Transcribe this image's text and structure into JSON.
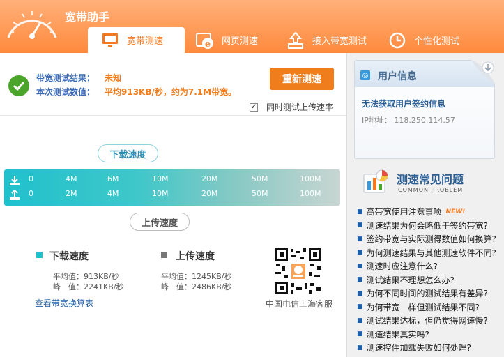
{
  "app": {
    "title": "宽带助手"
  },
  "tabs": [
    {
      "label": "宽带测速",
      "icon": "monitor-icon",
      "active": true
    },
    {
      "label": "网页测速",
      "icon": "ie-browser-icon",
      "active": false
    },
    {
      "label": "接入带宽测试",
      "icon": "upload-tray-icon",
      "active": false
    },
    {
      "label": "个性化测试",
      "icon": "clock-icon",
      "active": false
    }
  ],
  "result": {
    "bandwidth_label": "带宽测试结果：",
    "bandwidth_value": "未知",
    "speed_label": "本次测试数值：",
    "speed_value": "平均913KB/秒，约为7.1M带宽。",
    "retest_label": "重新测速",
    "upload_checkbox_label": "同时测试上传速率",
    "upload_checked": true
  },
  "meter": {
    "download_pill": "下载速度",
    "upload_pill": "上传速度",
    "download_ticks": [
      "0",
      "4M",
      "6M",
      "10M",
      "20M",
      "50M",
      "100M"
    ],
    "upload_ticks": [
      "0",
      "2M",
      "4M",
      "10M",
      "20M",
      "50M",
      "100M"
    ]
  },
  "stats": {
    "download_title": "下载速度",
    "download_avg": "平均值：913KB/秒",
    "download_peak": "峰　值：2241KB/秒",
    "upload_title": "上传速度",
    "upload_avg": "平均值：1245KB/秒",
    "upload_peak": "峰　值：2486KB/秒",
    "rate_table_link": "查看带宽换算表",
    "qr_caption": "中国电信上海客服"
  },
  "user_info": {
    "title": "用户信息",
    "warning": "无法获取用户签约信息",
    "ip": "IP地址： 118.250.114.57"
  },
  "faq": {
    "title": "测速常见问题",
    "subtitle": "COMMON PROBLEM",
    "new_badge": "NEW!",
    "items": [
      "高带宽使用注意事项",
      "测速结果为何会略低于签约带宽?",
      "签约带宽与实际测得数值如何换算?",
      "为何测速结果与其他测速软件不同?",
      "测速时应注意什么?",
      "测试结果不理想怎么办?",
      "为何不同时间的测试结果有差异?",
      "为何带宽一样但测试结果不同?",
      "测试结果达标，但仍觉得网速慢?",
      "测速结果真实吗?",
      "测速控件加载失败如何处理?"
    ]
  },
  "colors": {
    "brand_orange": "#ff8a3d",
    "accent_orange": "#f07d1c",
    "meter_teal": "#20c1cc",
    "link_blue": "#1f5fa8",
    "success_green": "#4aa52a"
  }
}
